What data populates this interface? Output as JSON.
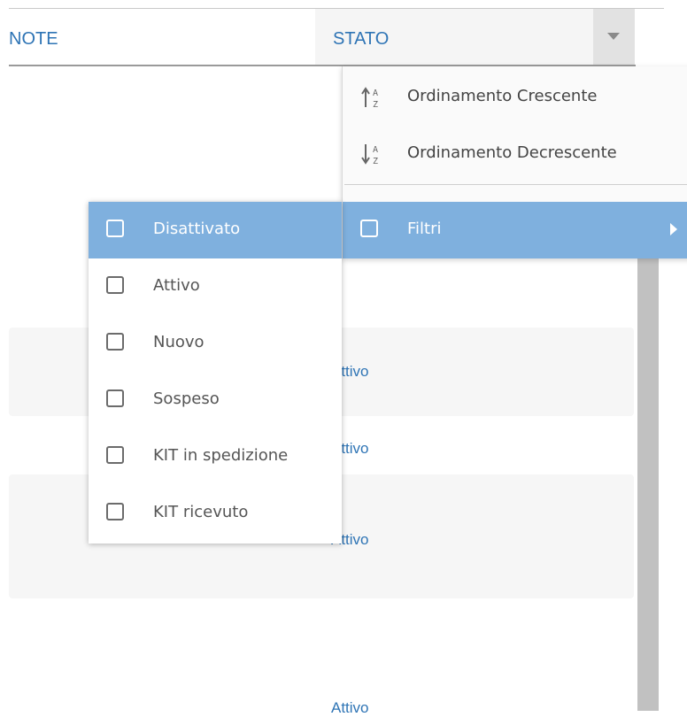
{
  "header": {
    "columns": [
      "NOTE",
      "STATO"
    ],
    "dropdown_icon": "caret-down-icon"
  },
  "rows": [
    {
      "stato": "Attivo"
    },
    {
      "stato": "Attivo"
    },
    {
      "stato": "Attivo"
    },
    {
      "stato": "Attivo"
    }
  ],
  "sort_menu": {
    "ascending_label": "Ordinamento Crescente",
    "descending_label": "Ordinamento Decrescente",
    "filters_label": "Filtri"
  },
  "filter_menu": {
    "options": [
      "Disattivato",
      "Attivo",
      "Nuovo",
      "Sospeso",
      "KIT in spedizione",
      "KIT ricevuto"
    ],
    "highlighted_option": "Disattivato"
  },
  "colors": {
    "link_blue": "#2e74b5",
    "highlight_blue": "#7fb0de"
  }
}
